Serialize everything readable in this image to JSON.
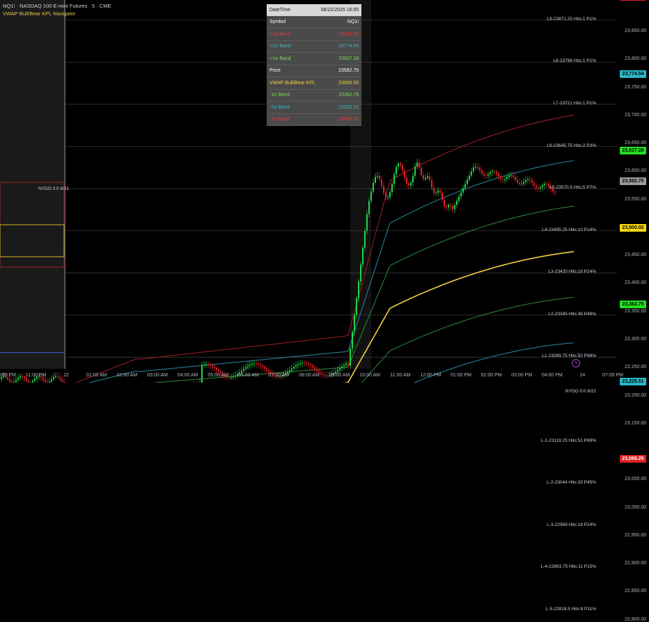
{
  "header": {
    "symbol_line": "NQ1! · NASDAQ 100 E-mini Futures · 5 · CME",
    "indicator_name": "VWAP Bull/Bear KPL Navigator"
  },
  "info_table": {
    "rows": [
      {
        "label": "DateTime",
        "value": "08/22/2025 16:55",
        "color": "#111111",
        "header": true
      },
      {
        "label": "Symbol",
        "value": "NQ1!",
        "color": "#ffffff"
      },
      {
        "label": "+3σ Band",
        "value": "23911.79",
        "color": "#e23b3b"
      },
      {
        "label": "+2σ Band",
        "value": "23774.54",
        "color": "#38b6c8"
      },
      {
        "label": "+1σ Band",
        "value": "23637.28",
        "color": "#7ed957"
      },
      {
        "label": "Price",
        "value": "23582.75",
        "color": "#ffffff"
      },
      {
        "label": "VWAP Bull/Bear KPL",
        "value": "23500.00",
        "color": "#f5d142"
      },
      {
        "label": "-1σ Band",
        "value": "23362.75",
        "color": "#7ed957"
      },
      {
        "label": "-2σ Band",
        "value": "23225.51",
        "color": "#38b6c8"
      },
      {
        "label": "-3σ Band",
        "value": "23088.25",
        "color": "#e23b3b"
      }
    ]
  },
  "price_axis": {
    "labels": [
      "23,850.00",
      "23,800.00",
      "23,750.00",
      "23,700.00",
      "23,650.00",
      "23,600.00",
      "23,550.00",
      "23,450.00",
      "23,400.00",
      "23,350.00",
      "23,300.00",
      "23,250.00",
      "23,200.00",
      "23,150.00",
      "23,050.00",
      "23,000.00",
      "22,950.00",
      "22,900.00",
      "22,850.00",
      "22,800.00"
    ],
    "values": [
      23850,
      23800,
      23750,
      23700,
      23650,
      23600,
      23550,
      23450,
      23400,
      23350,
      23300,
      23250,
      23200,
      23150,
      23050,
      23000,
      22950,
      22900,
      22850,
      22800
    ],
    "tags": [
      {
        "text": "23,911.79",
        "value": 23911.79,
        "bg": "#e02020",
        "fg": "#ffffff"
      },
      {
        "text": "23,774.54",
        "value": 23774.54,
        "bg": "#28b8c8",
        "fg": "#000000"
      },
      {
        "text": "23,637.28",
        "value": 23637.28,
        "bg": "#22e022",
        "fg": "#000000"
      },
      {
        "text": "23,582.75",
        "value": 23582.75,
        "bg": "#9a9a9a",
        "fg": "#000000"
      },
      {
        "text": "23,500.02",
        "value": 23500.02,
        "bg": "#f5d60f",
        "fg": "#000000"
      },
      {
        "text": "23,362.75",
        "value": 23362.75,
        "bg": "#22e022",
        "fg": "#000000"
      },
      {
        "text": "23,225.51",
        "value": 23225.51,
        "bg": "#28b8c8",
        "fg": "#000000"
      },
      {
        "text": "23,088.25",
        "value": 23088.25,
        "bg": "#e02020",
        "fg": "#ffffff"
      }
    ]
  },
  "time_axis": {
    "labels": [
      "10:00 PM",
      "11:00 PM",
      "22",
      "01:00 AM",
      "02:00 AM",
      "03:00 AM",
      "04:00 AM",
      "05:00 AM",
      "06:00 AM",
      "07:00 AM",
      "08:00 AM",
      "09:00 AM",
      "10:00 AM",
      "11:00 AM",
      "12:00 PM",
      "01:00 PM",
      "02:00 PM",
      "03:00 PM",
      "04:00 PM",
      "24",
      "07:00 PM"
    ]
  },
  "levels": [
    {
      "text": "L9-23871.25 Hits:1 P1%",
      "value": 23871.25
    },
    {
      "text": "L8-23796 Hits:1 P1%",
      "value": 23796
    },
    {
      "text": "L7-23721 Hits:1 P1%",
      "value": 23721
    },
    {
      "text": "L6-23645.75 Hits:2 P3%",
      "value": 23645.75
    },
    {
      "text": "L5-23570.5 Hits:5 P7%",
      "value": 23570.5
    },
    {
      "text": "L4-23495.25 Hits:10 P14%",
      "value": 23495.25
    },
    {
      "text": "L3-23420 Hits:18 P24%",
      "value": 23420
    },
    {
      "text": "L2-23345 Hits:36 P49%",
      "value": 23345
    },
    {
      "text": "L1-23269.75 Hits:50 P68%",
      "value": 23269.75
    },
    {
      "text": "NYDO 0:0 8/22",
      "value": 23207
    },
    {
      "text": "L-1-23119.25 Hits:51 P69%",
      "value": 23119.25
    },
    {
      "text": "L-2-23044 Hits:33 P45%",
      "value": 23044
    },
    {
      "text": "L-3-22969 Hits:18 P24%",
      "value": 22969
    },
    {
      "text": "L-4-22893.75 Hits:11 P15%",
      "value": 22893.75
    },
    {
      "text": "L-5-22818.5 Hits:8 P11%",
      "value": 22818.5
    }
  ],
  "prev_session_label": "NYDO 0:0 8/21",
  "colors": {
    "bull": "#22d44a",
    "bear": "#e0222a",
    "vwap": "#f5d142",
    "band1": "#2e8b3c",
    "band2": "#2a8aa0",
    "band3": "#a3202a",
    "nydo": "#3a66d8"
  }
}
